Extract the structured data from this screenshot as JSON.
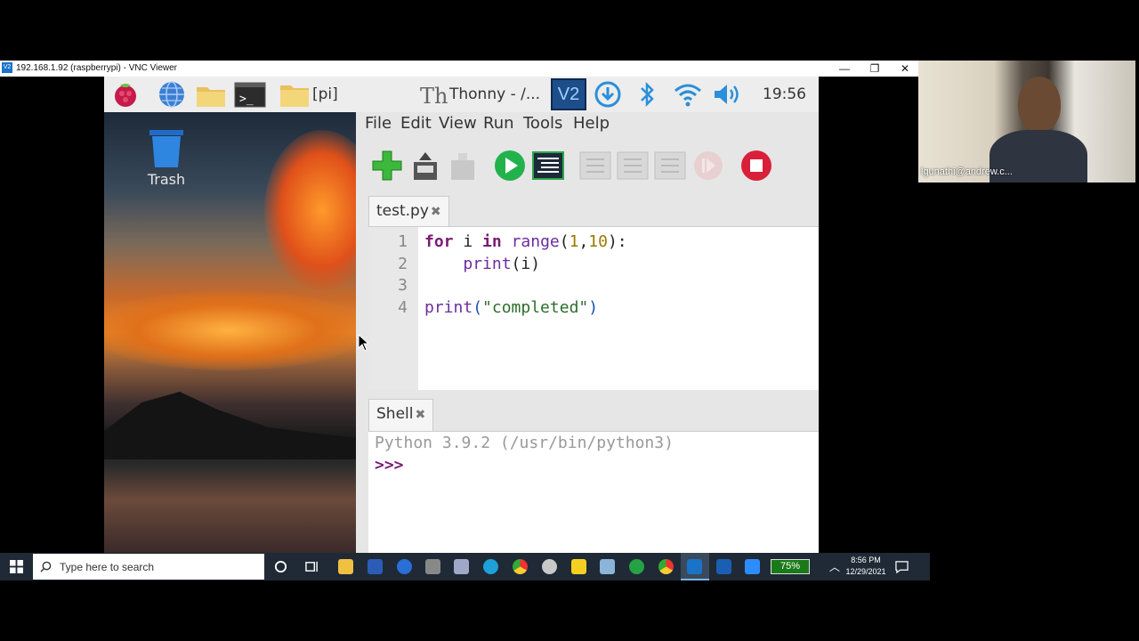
{
  "vnc": {
    "title": "192.168.1.92 (raspberrypi) - VNC Viewer",
    "logo": "V2",
    "minimize": "—",
    "restore": "❐",
    "close": "✕"
  },
  "rpi_panel": {
    "folder_label": "[pi]",
    "app_label": "Thonny - /...",
    "vnc_label": "V2",
    "clock": "19:56",
    "icons": [
      "raspberry-menu-icon",
      "browser-icon",
      "file-manager-icon",
      "terminal-icon",
      "folder-icon",
      "thonny-icon",
      "vnc-server-icon",
      "download-icon",
      "bluetooth-icon",
      "wifi-icon",
      "volume-icon"
    ]
  },
  "desktop": {
    "trash_label": "Trash"
  },
  "thonny": {
    "menu": [
      "File",
      "Edit",
      "View",
      "Run",
      "Tools",
      "Help"
    ],
    "editor_tab": "test.py",
    "shell_tab": "Shell",
    "line_numbers": [
      "1",
      "2",
      "3",
      "4"
    ],
    "code": {
      "l1_kw1": "for",
      "l1_var": " i ",
      "l1_kw2": "in",
      "l1_sp": " ",
      "l1_fn": "range",
      "l1_p1": "(",
      "l1_n1": "1",
      "l1_comma": ",",
      "l1_n2": "10",
      "l1_p2": "):",
      "l2_indent": "    ",
      "l2_fn": "print",
      "l2_args": "(i)",
      "l4_fn": "print",
      "l4_p1": "(",
      "l4_str": "\"completed\"",
      "l4_p2": ")"
    },
    "shell": {
      "banner": "Python 3.9.2 (/usr/bin/python3)",
      "prompt": ">>>"
    }
  },
  "taskbar": {
    "search_placeholder": "Type here to search",
    "battery": "75%",
    "time": "8:56 PM",
    "date": "12/29/2021"
  },
  "webcam": {
    "name": "lgunathi@andrew.c..."
  },
  "colors": {
    "thonny_bg": "#e6e6e6",
    "keyword": "#7a1b73",
    "string": "#2c6e2c",
    "number": "#9a7a00",
    "prompt": "#7a1b73",
    "taskbar": "#1f2a36"
  }
}
